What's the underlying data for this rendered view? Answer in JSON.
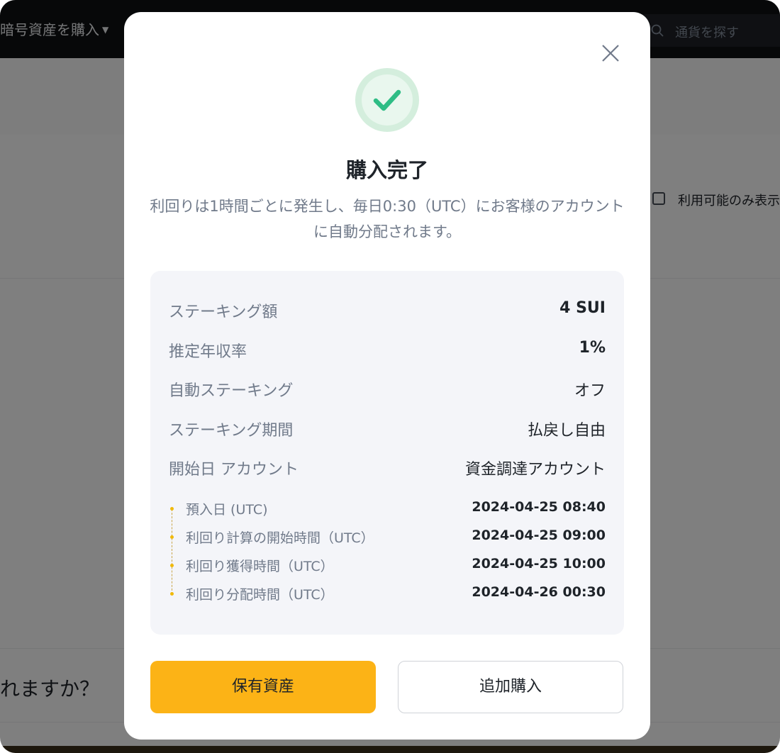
{
  "background": {
    "topbar": {
      "buy_menu_label": "暗号資産を購入",
      "search_placeholder": "通貨を探す"
    },
    "filter": {
      "available_only_label": "利用可能のみ表示"
    },
    "faq_fragment": "れますか？"
  },
  "modal": {
    "title": "購入完了",
    "description": "利回りは1時間ごとに発生し、毎日0:30（UTC）にお客様のアカウントに自動分配されます。",
    "summary": [
      {
        "label": "ステーキング額",
        "value": "4 SUI"
      },
      {
        "label": "推定年収率",
        "value": "1%"
      },
      {
        "label": "自動ステーキング",
        "value": "オフ"
      },
      {
        "label": "ステーキング期間",
        "value": "払戻し自由"
      },
      {
        "label": "開始日 アカウント",
        "value": "資金調達アカウント"
      }
    ],
    "timeline": [
      {
        "label": "預入日 (UTC)",
        "value": "2024-04-25 08:40"
      },
      {
        "label": "利回り計算の開始時間（UTC）",
        "value": "2024-04-25 09:00"
      },
      {
        "label": "利回り獲得時間（UTC）",
        "value": "2024-04-25 10:00"
      },
      {
        "label": "利回り分配時間（UTC）",
        "value": "2024-04-26 00:30"
      }
    ],
    "buttons": {
      "primary": "保有資産",
      "secondary": "追加購入"
    },
    "icons": {
      "success": "check-circle-icon",
      "close": "close-icon"
    },
    "colors": {
      "accent": "#fcb316",
      "success": "#2ebd85",
      "success_bg": "#e2f4ea"
    }
  }
}
